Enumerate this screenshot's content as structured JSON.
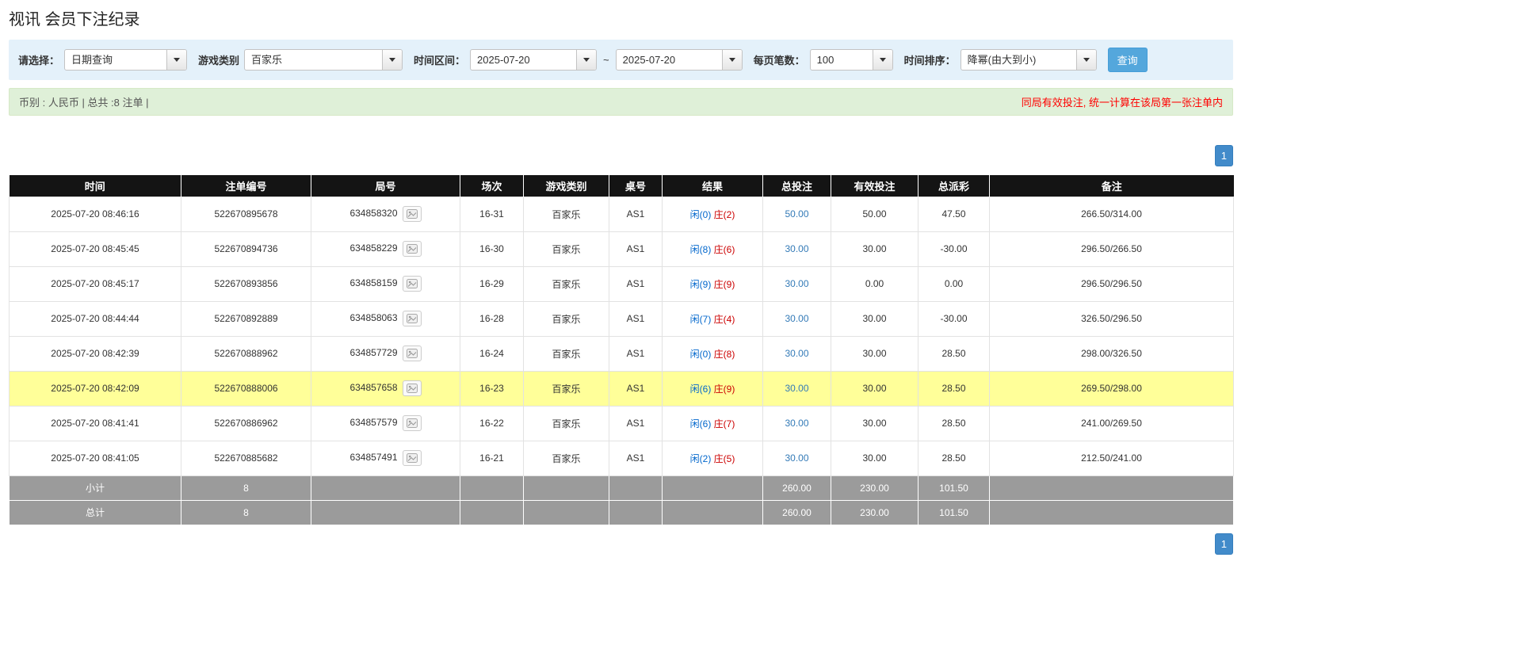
{
  "page": {
    "title": "视讯 会员下注纪录"
  },
  "colors": {
    "filter_bar_bg": "#e4f1fa",
    "notice_bar_bg": "#dff0d8",
    "warning_text": "#ff0000",
    "header_bg": "#141414",
    "summary_row_bg": "#9b9b9b",
    "highlight_row_bg": "#ffff99",
    "player_blue": "#0066cc",
    "banker_red": "#cc0000",
    "negative_red": "#e60000",
    "link_blue": "#337ab7",
    "search_button_blue": "#54a7dc",
    "pagination_blue": "#428bca"
  },
  "filters": {
    "select_label": "请选择：",
    "select_value": "日期查询",
    "game_type_label": "游戏类别",
    "game_type_value": "百家乐",
    "time_range_label": "时间区间：",
    "date_from": "2025-07-20",
    "tilde": "~",
    "date_to": "2025-07-20",
    "page_size_label": "每页笔数：",
    "page_size_value": "100",
    "sort_label": "时间排序：",
    "sort_value": "降幂(由大到小)",
    "search_button": "查询"
  },
  "summary_bar": {
    "left": "币别 : 人民币 | 总共 :8 注单 |",
    "right": "同局有效投注, 统一计算在该局第一张注单内"
  },
  "pagination": {
    "page": "1"
  },
  "table": {
    "headers": [
      "时间",
      "注单编号",
      "局号",
      "场次",
      "游戏类别",
      "桌号",
      "结果",
      "总投注",
      "有效投注",
      "总派彩",
      "备注"
    ],
    "rows": [
      {
        "time": "2025-07-20 08:46:16",
        "bet_id": "522670895678",
        "round_id": "634858320",
        "session": "16-31",
        "game": "百家乐",
        "table_no": "AS1",
        "result_player": "闲(0)",
        "result_banker": "庄(2)",
        "total_bet": "50.00",
        "valid_bet": "50.00",
        "payout": "47.50",
        "note": "266.50/314.00",
        "highlight": false
      },
      {
        "time": "2025-07-20 08:45:45",
        "bet_id": "522670894736",
        "round_id": "634858229",
        "session": "16-30",
        "game": "百家乐",
        "table_no": "AS1",
        "result_player": "闲(8)",
        "result_banker": "庄(6)",
        "total_bet": "30.00",
        "valid_bet": "30.00",
        "payout": "-30.00",
        "note": "296.50/266.50",
        "highlight": false
      },
      {
        "time": "2025-07-20 08:45:17",
        "bet_id": "522670893856",
        "round_id": "634858159",
        "session": "16-29",
        "game": "百家乐",
        "table_no": "AS1",
        "result_player": "闲(9)",
        "result_banker": "庄(9)",
        "total_bet": "30.00",
        "valid_bet": "0.00",
        "payout": "0.00",
        "note": "296.50/296.50",
        "highlight": false
      },
      {
        "time": "2025-07-20 08:44:44",
        "bet_id": "522670892889",
        "round_id": "634858063",
        "session": "16-28",
        "game": "百家乐",
        "table_no": "AS1",
        "result_player": "闲(7)",
        "result_banker": "庄(4)",
        "total_bet": "30.00",
        "valid_bet": "30.00",
        "payout": "-30.00",
        "note": "326.50/296.50",
        "highlight": false
      },
      {
        "time": "2025-07-20 08:42:39",
        "bet_id": "522670888962",
        "round_id": "634857729",
        "session": "16-24",
        "game": "百家乐",
        "table_no": "AS1",
        "result_player": "闲(0)",
        "result_banker": "庄(8)",
        "total_bet": "30.00",
        "valid_bet": "30.00",
        "payout": "28.50",
        "note": "298.00/326.50",
        "highlight": false
      },
      {
        "time": "2025-07-20 08:42:09",
        "bet_id": "522670888006",
        "round_id": "634857658",
        "session": "16-23",
        "game": "百家乐",
        "table_no": "AS1",
        "result_player": "闲(6)",
        "result_banker": "庄(9)",
        "total_bet": "30.00",
        "valid_bet": "30.00",
        "payout": "28.50",
        "note": "269.50/298.00",
        "highlight": true
      },
      {
        "time": "2025-07-20 08:41:41",
        "bet_id": "522670886962",
        "round_id": "634857579",
        "session": "16-22",
        "game": "百家乐",
        "table_no": "AS1",
        "result_player": "闲(6)",
        "result_banker": "庄(7)",
        "total_bet": "30.00",
        "valid_bet": "30.00",
        "payout": "28.50",
        "note": "241.00/269.50",
        "highlight": false
      },
      {
        "time": "2025-07-20 08:41:05",
        "bet_id": "522670885682",
        "round_id": "634857491",
        "session": "16-21",
        "game": "百家乐",
        "table_no": "AS1",
        "result_player": "闲(2)",
        "result_banker": "庄(5)",
        "total_bet": "30.00",
        "valid_bet": "30.00",
        "payout": "28.50",
        "note": "212.50/241.00",
        "highlight": false
      }
    ],
    "subtotal": {
      "label": "小计",
      "count": "8",
      "total_bet": "260.00",
      "valid_bet": "230.00",
      "payout": "101.50"
    },
    "total": {
      "label": "总计",
      "count": "8",
      "total_bet": "260.00",
      "valid_bet": "230.00",
      "payout": "101.50"
    }
  }
}
